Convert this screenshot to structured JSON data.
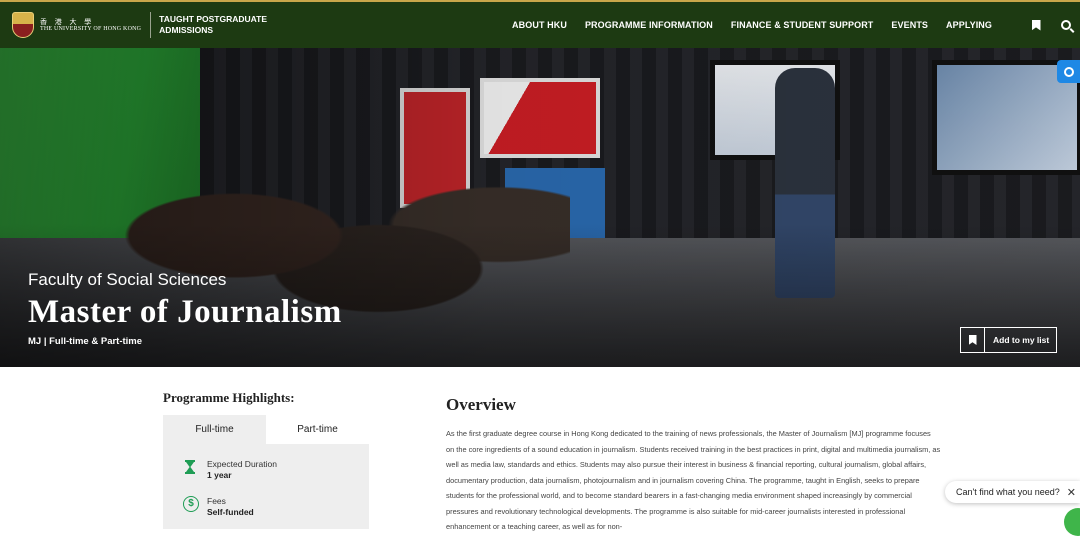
{
  "header": {
    "logo_cn": "香 港 大 學",
    "logo_en": "THE UNIVERSITY OF HONG KONG",
    "section_title": "TAUGHT POSTGRADUATE ADMISSIONS",
    "nav": [
      "ABOUT HKU",
      "PROGRAMME INFORMATION",
      "FINANCE & STUDENT SUPPORT",
      "EVENTS",
      "APPLYING"
    ],
    "icons": [
      "bookmark-icon",
      "search-icon"
    ]
  },
  "hero": {
    "faculty": "Faculty of Social Sciences",
    "title": "Master of Journalism",
    "subtitle": "MJ | Full-time & Part-time",
    "add_to_list": "Add to my list",
    "share_icon": "share-icon"
  },
  "highlights": {
    "title": "Programme Highlights:",
    "tabs": [
      "Full-time",
      "Part-time"
    ],
    "active_tab": "Full-time",
    "items": [
      {
        "icon": "hourglass-icon",
        "label": "Expected Duration",
        "value": "1 year"
      },
      {
        "icon": "dollar-icon",
        "label": "Fees",
        "value": "Self-funded"
      }
    ]
  },
  "overview": {
    "title": "Overview",
    "body": "As the first graduate degree course in Hong Kong dedicated to the training of news professionals, the Master of Journalism [MJ] programme focuses on the core ingredients of a sound education in journalism. Students received training in the best practices in print, digital and multimedia journalism, as well as media law, standards and ethics. Students may also pursue their interest in business & financial reporting, cultural journalism, global affairs, documentary production, data journalism, photojournalism and in journalism covering China. The programme, taught in English, seeks to prepare students for the professional world, and to become standard bearers in a fast-changing media environment shaped increasingly by commercial pressures and revolutionary technological developments. The programme is also suitable for mid-career journalists interested in professional enhancement or a teaching career, as well as for non-"
  },
  "chat": {
    "prompt": "Can't find what you need?",
    "close": "✕"
  },
  "colors": {
    "header_bg": "#1d3a12",
    "accent_green": "#1f9d55",
    "panel_bg": "#eeeeee"
  }
}
